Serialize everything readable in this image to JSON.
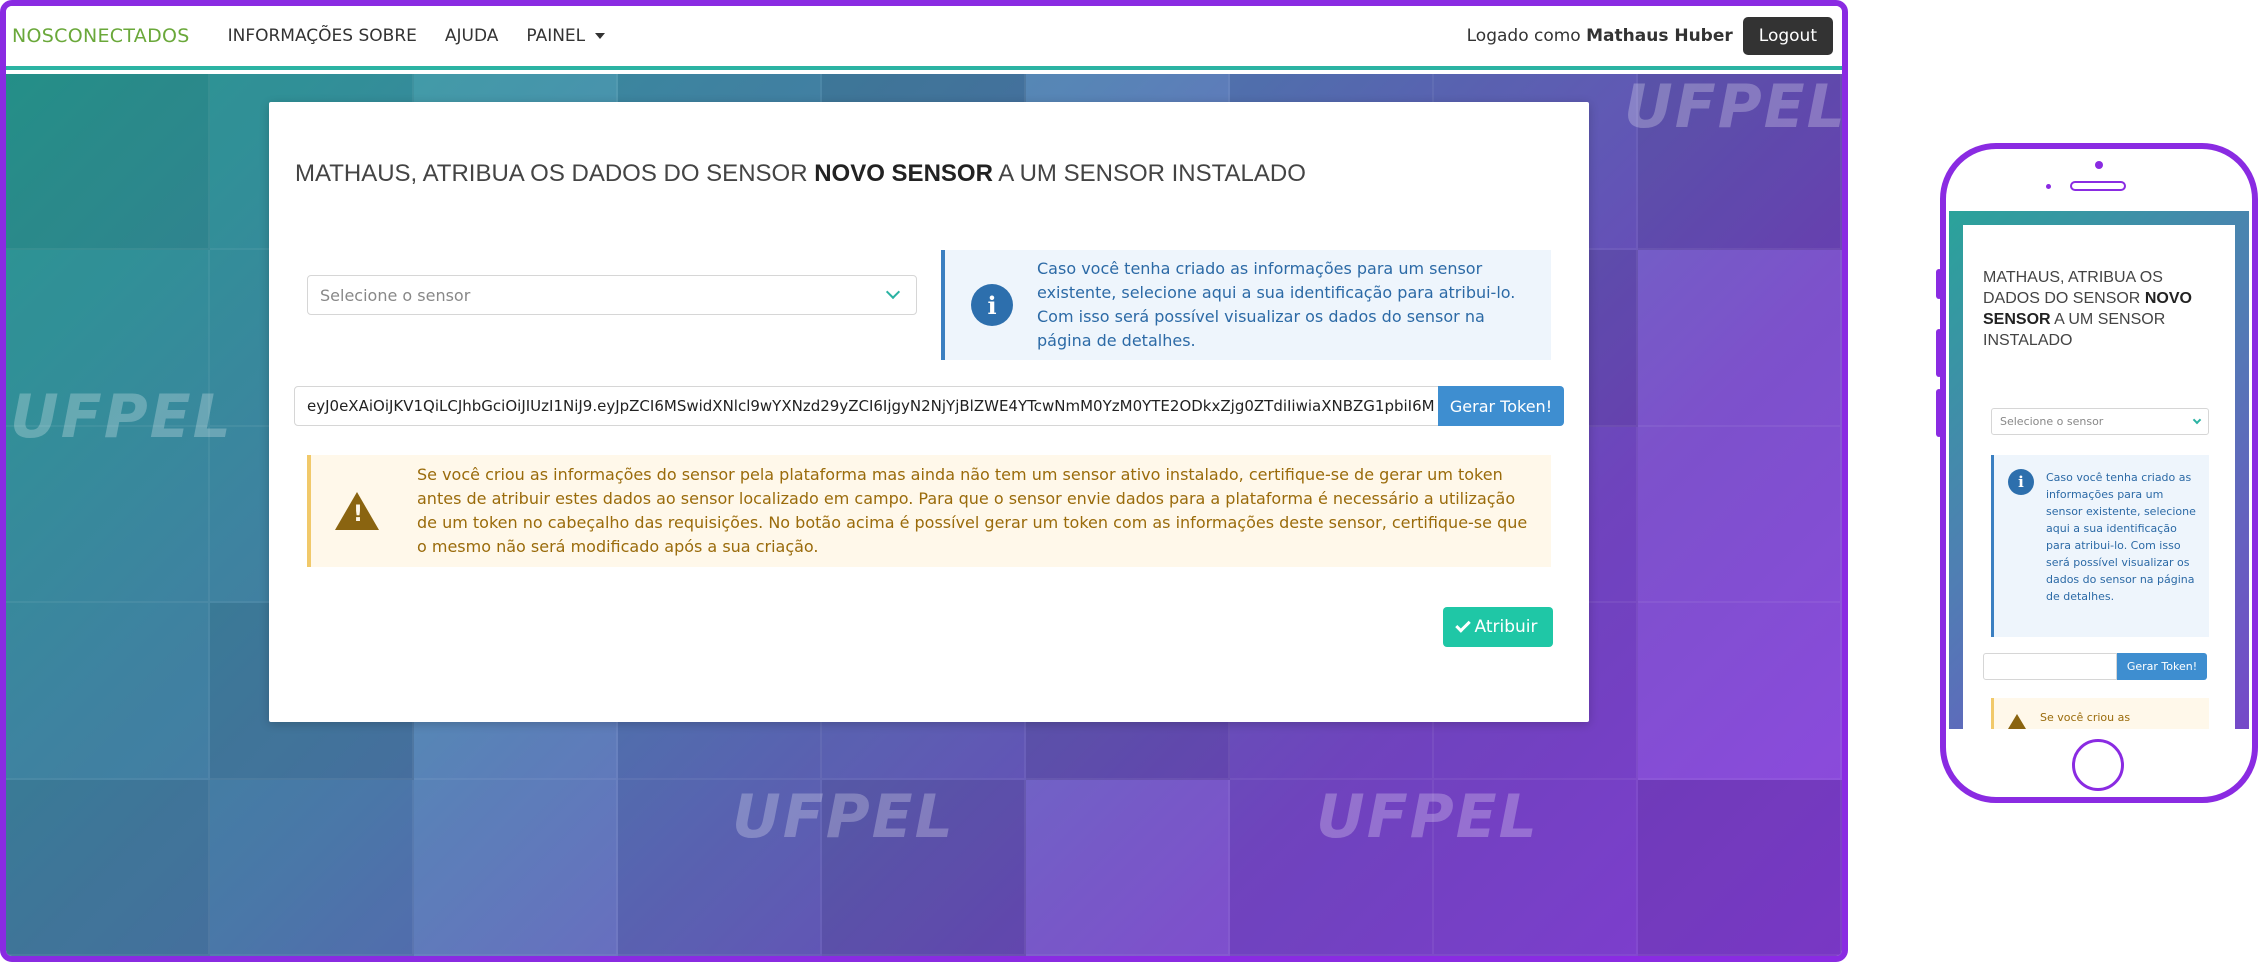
{
  "navbar": {
    "brand": "NOSCONECTADOS",
    "items": [
      {
        "label": "INFORMAÇÕES SOBRE"
      },
      {
        "label": "AJUDA"
      },
      {
        "label": "PAINEL"
      }
    ],
    "logged_prefix": "Logado como",
    "user_name": "Mathaus Huber",
    "logout_label": "Logout"
  },
  "background": {
    "watermark": "UFPEL"
  },
  "panel": {
    "title_prefix": "MATHAUS, ATRIBUA OS DADOS DO SENSOR",
    "title_sensor": "NOVO SENSOR",
    "title_suffix": "A UM SENSOR INSTALADO",
    "select_placeholder": "Selecione o sensor",
    "info_text": "Caso você tenha criado as informações para um sensor existente, selecione aqui a sua identificação para atribui-lo. Com isso será possível visualizar os dados do sensor na página de detalhes.",
    "token_value": "eyJ0eXAiOiJKV1QiLCJhbGciOiJIUzI1NiJ9.eyJpZCI6MSwidXNlcl9wYXNzd29yZCI6IjgyN2NjYjBlZWE4YTcwNmM0YzM0YTE2ODkxZjg0ZTdiIiwiaXNBZG1pbiI6M",
    "token_button": "Gerar Token!",
    "warning_text": "Se você criou as informações do sensor pela plataforma mas ainda não tem um sensor ativo instalado, certifique-se de gerar um token antes de atribuir estes dados ao sensor localizado em campo. Para que o sensor envie dados para a plataforma é necessário a utilização de um token no cabeçalho das requisições. No botão acima é possível gerar um token com as informações deste sensor, certifique-se que o mesmo não será modificado após a sua criação.",
    "assign_button": "Atribuir"
  },
  "mobile": {
    "title_prefix": "MATHAUS, ATRIBUA OS DADOS DO SENSOR",
    "title_sensor": "NOVO SENSOR",
    "title_suffix": "A UM SENSOR INSTALADO",
    "select_placeholder": "Selecione o sensor",
    "info_text": "Caso você tenha criado as informações para um sensor existente, selecione aqui a sua identificação para atribui-lo. Com isso será possível visualizar os dados do sensor na página de detalhes.",
    "token_button": "Gerar Token!",
    "warning_text": "Se você criou as"
  },
  "colors": {
    "accent_frame": "#8a2be2",
    "brand": "#6aa83a",
    "teal": "#1fc7a6",
    "blue_button": "#3e8ed0",
    "info_blue": "#2d6fad",
    "warning_text": "#9a6b0b"
  }
}
